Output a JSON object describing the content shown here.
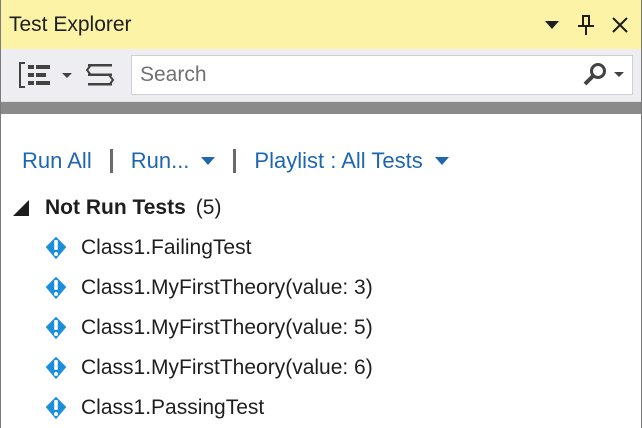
{
  "window": {
    "title": "Test Explorer"
  },
  "title_buttons": {
    "dropdown_icon": "window-position-dropdown-icon",
    "pin_icon": "pin-icon",
    "close_icon": "close-icon"
  },
  "toolbar": {
    "hierarchy_icon": "group-by-hierarchy-icon",
    "group_icon": "group-by-icon",
    "search_placeholder": "Search",
    "search_icon": "search-icon"
  },
  "commands": {
    "run_all": "Run All",
    "run": "Run...",
    "playlist": "Playlist : All Tests"
  },
  "tree": {
    "group": {
      "label": "Not Run Tests",
      "count": "(5)",
      "expanded": true
    },
    "tests": [
      {
        "name": "Class1.FailingTest",
        "status": "not-run"
      },
      {
        "name": "Class1.MyFirstTheory(value: 3)",
        "status": "not-run"
      },
      {
        "name": "Class1.MyFirstTheory(value: 5)",
        "status": "not-run"
      },
      {
        "name": "Class1.MyFirstTheory(value: 6)",
        "status": "not-run"
      },
      {
        "name": "Class1.PassingTest",
        "status": "not-run"
      }
    ]
  },
  "colors": {
    "titlebar_bg": "#fdf3a7",
    "toolbar_bg": "#eeeef2",
    "command_link": "#1e66b0",
    "not_run_icon": "#1b8ee0",
    "splitter": "#8a8a8a"
  }
}
